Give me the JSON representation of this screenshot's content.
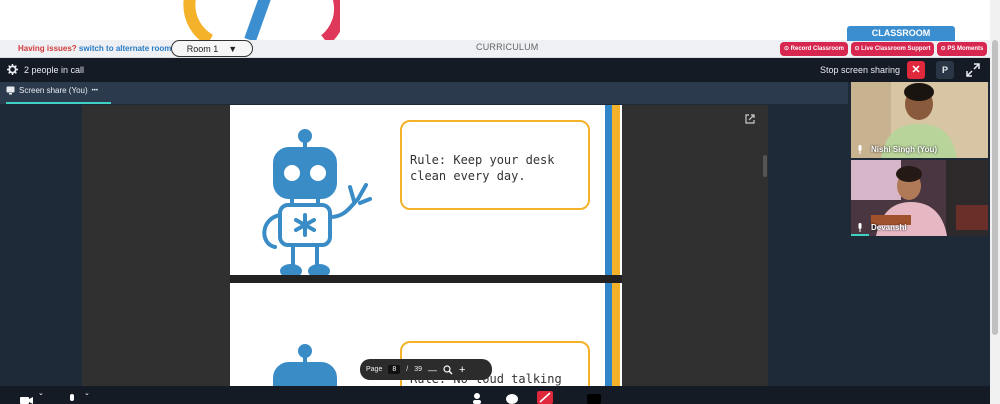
{
  "info_bar": {
    "issues_label": "Having issues?",
    "alternate_label": "switch to alternate room",
    "room_value": "Room 1",
    "curriculum_label": "CURRICULUM",
    "classroom_tab": "CLASSROOM",
    "record_label": "Record Classroom",
    "support_label": "Live Classroom Support",
    "moments_label": "PS Moments"
  },
  "call": {
    "people_count": "2 people in call",
    "stop_share_label": "Stop screen sharing",
    "stop_x": "✕",
    "p_button": "P",
    "share_tab_label": "Screen share (You)",
    "share_tab_more": "•••"
  },
  "slides": {
    "rule1": "Rule: Keep your desk clean every day.",
    "rule2": "Rule: No loud talking"
  },
  "pager": {
    "page_label": "Page",
    "current": "8",
    "separator": "/",
    "total": "39",
    "minus": "—",
    "plus": "+"
  },
  "participants": [
    {
      "name": "Nishi Singh (You)"
    },
    {
      "name": "Devanshi"
    }
  ],
  "colors": {
    "call_bg": "#1f2a38",
    "stop_red": "#e0283c",
    "pill_red": "#d7264f",
    "classroom_blue": "#3b8ed0",
    "robot_blue": "#3a8cc7",
    "slide_yellow": "#f4b22a"
  }
}
